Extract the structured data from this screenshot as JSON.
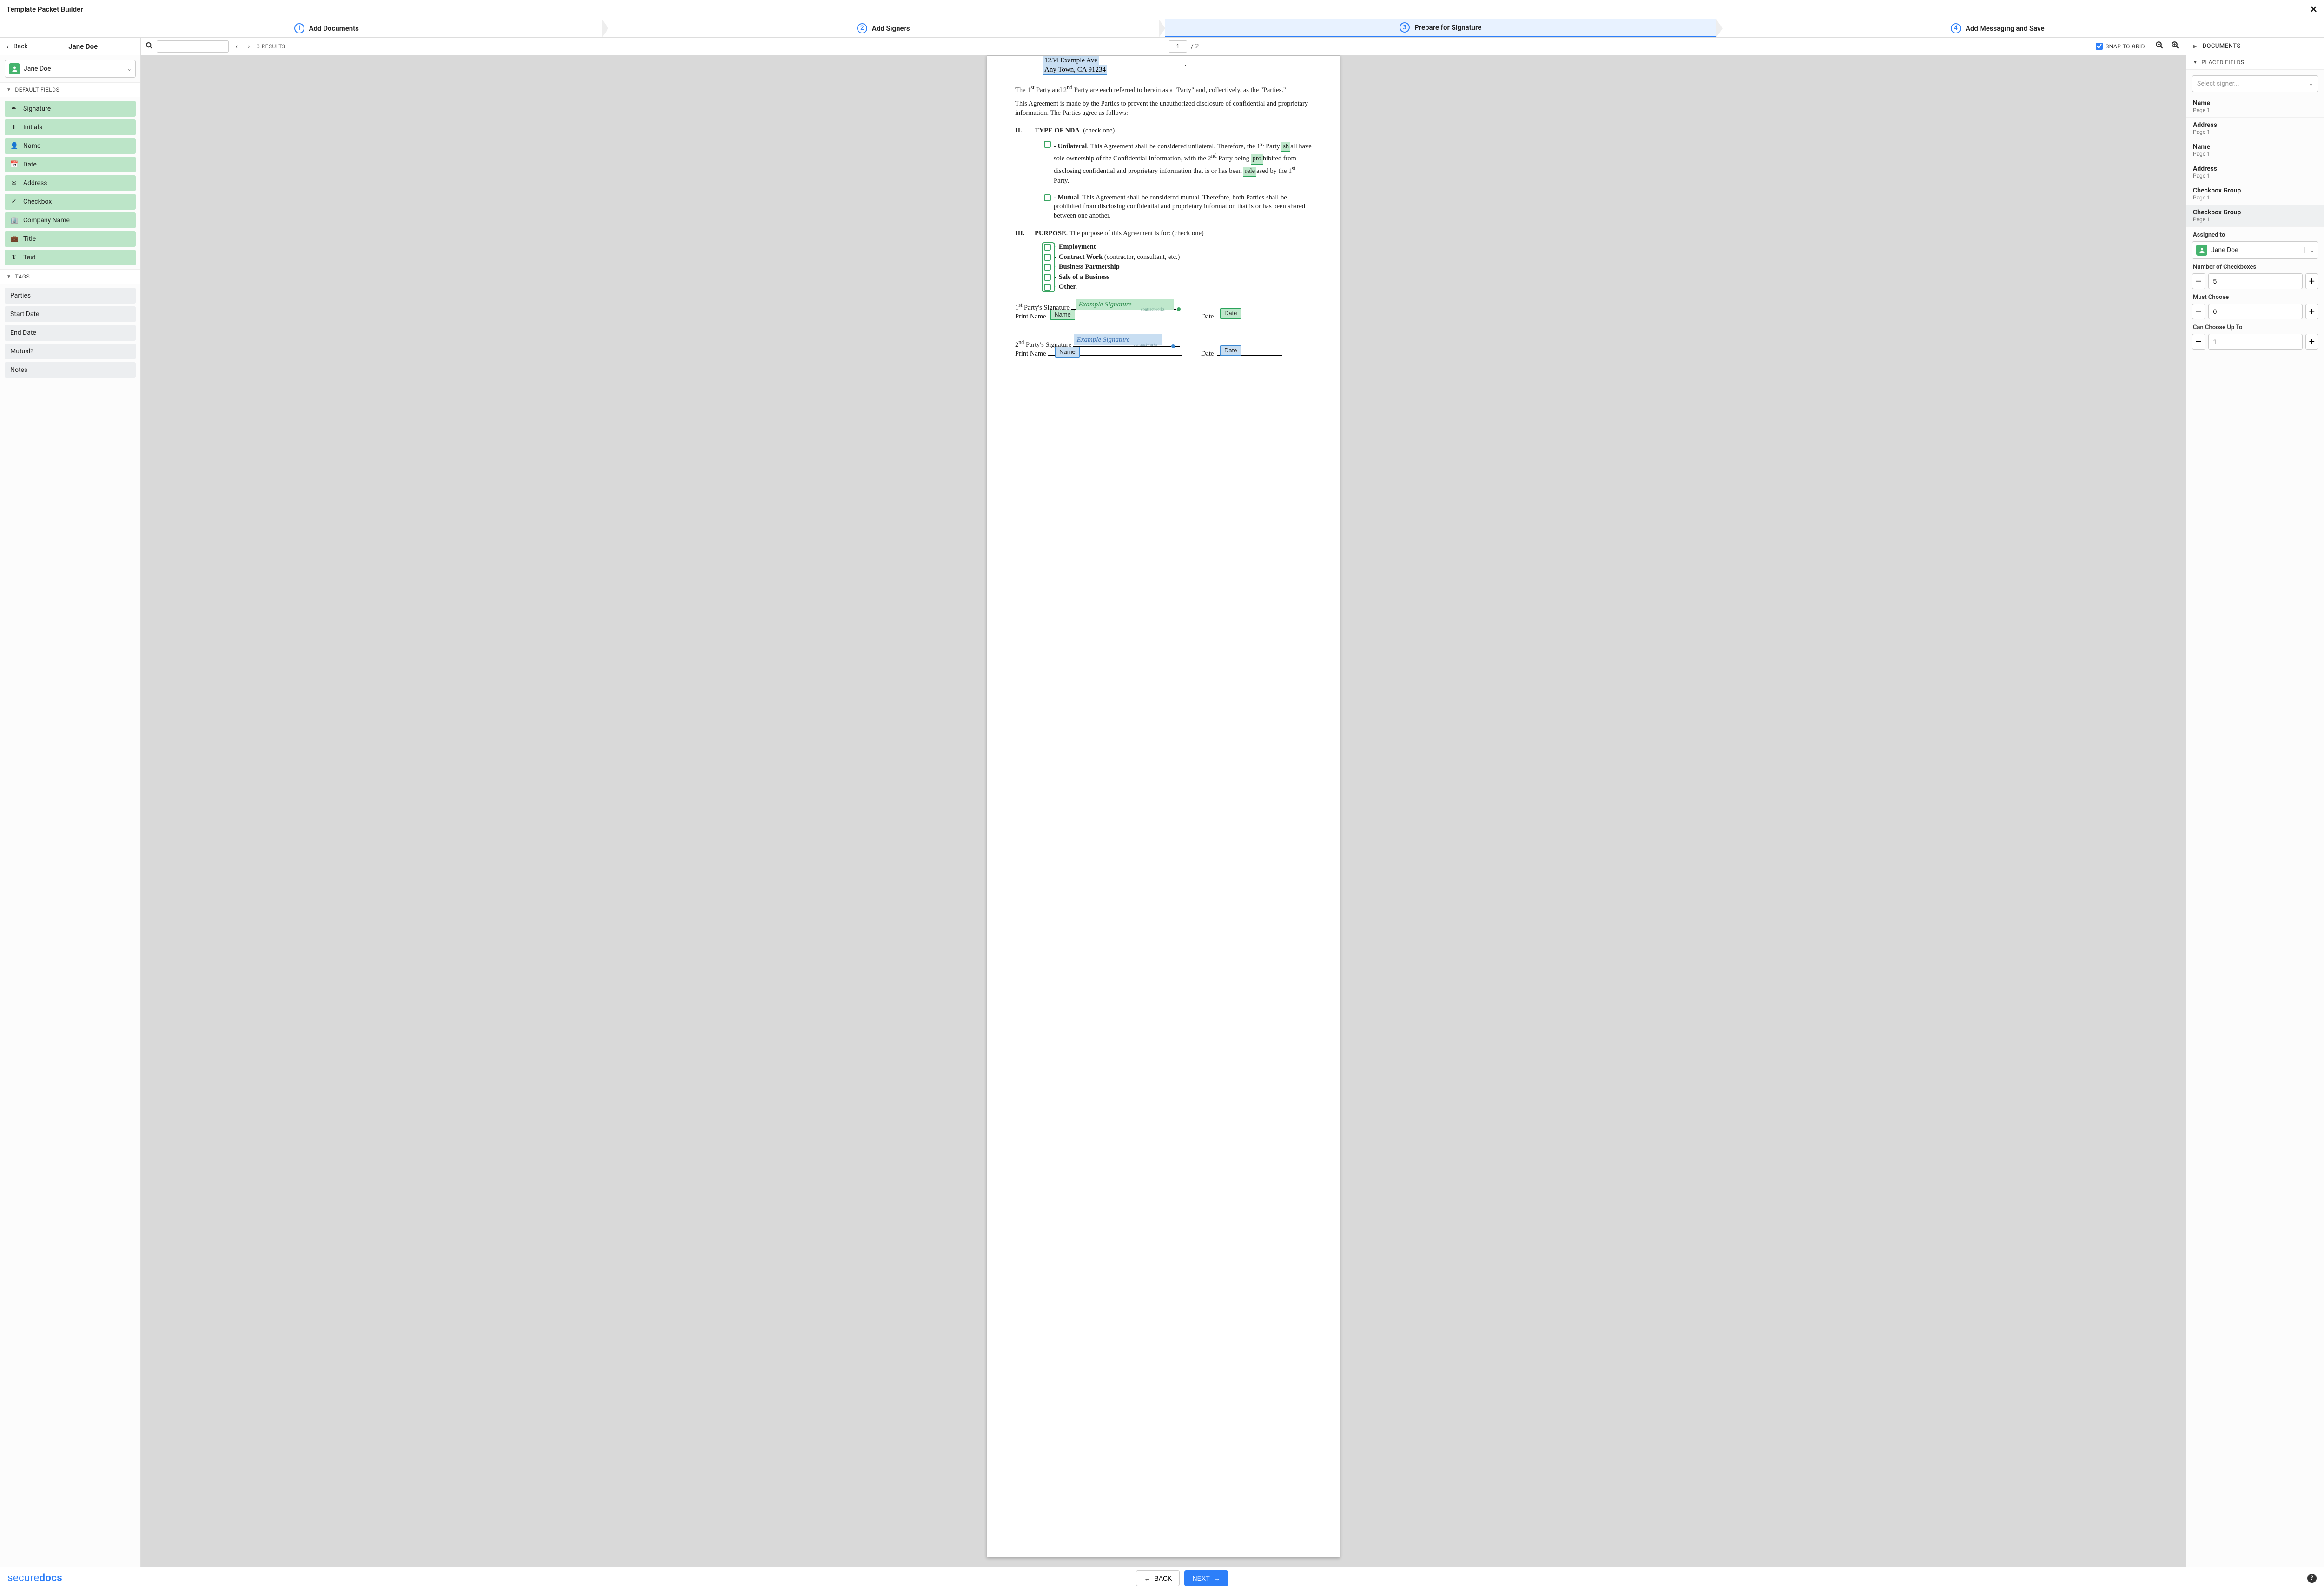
{
  "titlebar": {
    "title": "Template Packet Builder"
  },
  "steps": [
    {
      "num": "1",
      "label": "Add Documents"
    },
    {
      "num": "2",
      "label": "Add Signers"
    },
    {
      "num": "3",
      "label": "Prepare for Signature"
    },
    {
      "num": "4",
      "label": "Add Messaging and Save"
    }
  ],
  "toolbar": {
    "back": "Back",
    "signer": "Jane Doe",
    "results": "0 RESULTS",
    "page": "1",
    "page_total": "/ 2",
    "snap": "SNAP TO GRID",
    "documents_label": "DOCUMENTS"
  },
  "left": {
    "current_signer": "Jane Doe",
    "default_fields_label": "DEFAULT FIELDS",
    "tags_label": "TAGS",
    "fields": [
      {
        "icon": "✒",
        "label": "Signature"
      },
      {
        "icon": "I",
        "label": "Initials"
      },
      {
        "icon": "👤",
        "label": "Name"
      },
      {
        "icon": "📅",
        "label": "Date"
      },
      {
        "icon": "✉",
        "label": "Address"
      },
      {
        "icon": "✓",
        "label": "Checkbox"
      },
      {
        "icon": "🏢",
        "label": "Company Name"
      },
      {
        "icon": "💼",
        "label": "Title"
      },
      {
        "icon": "T",
        "label": "Text"
      }
    ],
    "tags": [
      {
        "label": "Parties"
      },
      {
        "label": "Start Date"
      },
      {
        "label": "End Date"
      },
      {
        "label": "Mutual?"
      },
      {
        "label": "Notes"
      }
    ]
  },
  "doc": {
    "addr1": "1234 Example Ave",
    "addr2": "Any Town, CA 91234",
    "parties_para": "The 1st Party and 2nd Party are each referred to herein as a \"Party\" and, collectively, as the \"Parties.\"",
    "agreement_para": "This Agreement is made by the Parties to prevent the unauthorized disclosure of confidential and proprietary information. The Parties agree as follows:",
    "sec2_num": "II.",
    "sec2_title": "TYPE OF NDA",
    "sec2_check": ". (check one)",
    "opt_unilateral_title": "Unilateral",
    "opt_unilateral_body": "This Agreement shall be considered unilateral. Therefore, the 1st Party shall have sole ownership of the Confidential Information, with the 2nd Party being prohibited from disclosing confidential and proprietary information that is or has been released by the 1st Party.",
    "opt_mutual_title": "Mutual",
    "opt_mutual_body": "This Agreement shall be considered mutual. Therefore, both Parties shall be prohibited from disclosing confidential and proprietary information that is or has been shared between one another.",
    "sec3_num": "III.",
    "sec3_title": "PURPOSE",
    "sec3_body": ". The purpose of this Agreement is for: (check one)",
    "purpose_opts": [
      "Employment",
      "Contract Work (contractor, consultant, etc.)",
      "Business Partnership",
      "Sale of a Business",
      "Other."
    ],
    "sig1_label": "1st Party's Signature",
    "sig2_label": "2nd Party's Signature",
    "print_name": "Print Name",
    "date_label": "Date",
    "example_sig": "Example Signature",
    "name_field": "Name",
    "date_field": "Date",
    "brand_tag": "contractworks"
  },
  "right": {
    "placed_fields_label": "PLACED FIELDS",
    "select_signer_ph": "Select signer...",
    "items": [
      {
        "title": "Name",
        "page": "Page 1"
      },
      {
        "title": "Address",
        "page": "Page 1"
      },
      {
        "title": "Name",
        "page": "Page 1"
      },
      {
        "title": "Address",
        "page": "Page 1"
      },
      {
        "title": "Checkbox Group",
        "page": "Page 1"
      },
      {
        "title": "Checkbox Group",
        "page": "Page 1"
      }
    ],
    "assigned_to_label": "Assigned to",
    "assigned_to_value": "Jane Doe",
    "num_cb_label": "Number of Checkboxes",
    "num_cb_value": "5",
    "must_choose_label": "Must Choose",
    "must_choose_value": "0",
    "can_choose_label": "Can Choose Up To",
    "can_choose_value": "1"
  },
  "footer": {
    "brand1": "secure",
    "brand2": "docs",
    "back": "BACK",
    "next": "NEXT"
  }
}
